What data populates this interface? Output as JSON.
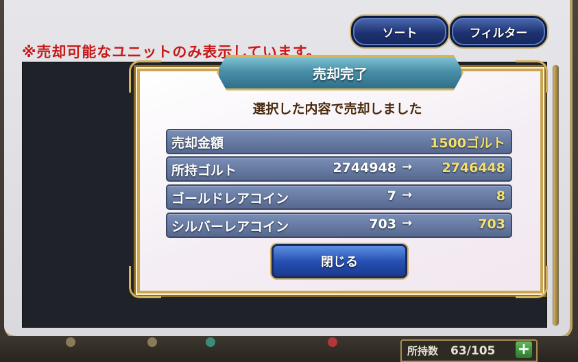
{
  "notice": "※売却可能なユニットのみ表示しています。",
  "top_buttons": {
    "sort": "ソート",
    "filter": "フィルター"
  },
  "dialog": {
    "title": "売却完了",
    "message": "選択した内容で売却しました",
    "rows": [
      {
        "label": "売却金額",
        "from": "",
        "arrow": "",
        "to": "1500ゴルト"
      },
      {
        "label": "所持ゴルト",
        "from": "2744948",
        "arrow": "→",
        "to": "2746448"
      },
      {
        "label": "ゴールドレアコイン",
        "from": "7",
        "arrow": "→",
        "to": "8"
      },
      {
        "label": "シルバーレアコイン",
        "from": "703",
        "arrow": "→",
        "to": "703"
      }
    ],
    "close_label": "閉じる"
  },
  "footer": {
    "count_label": "所持数",
    "count_value": "63/105",
    "plus_icon": "plus-icon"
  },
  "colors": {
    "notice": "#c81818",
    "value_highlight": "#f6e06a",
    "gold_frame": "#c9a551"
  }
}
